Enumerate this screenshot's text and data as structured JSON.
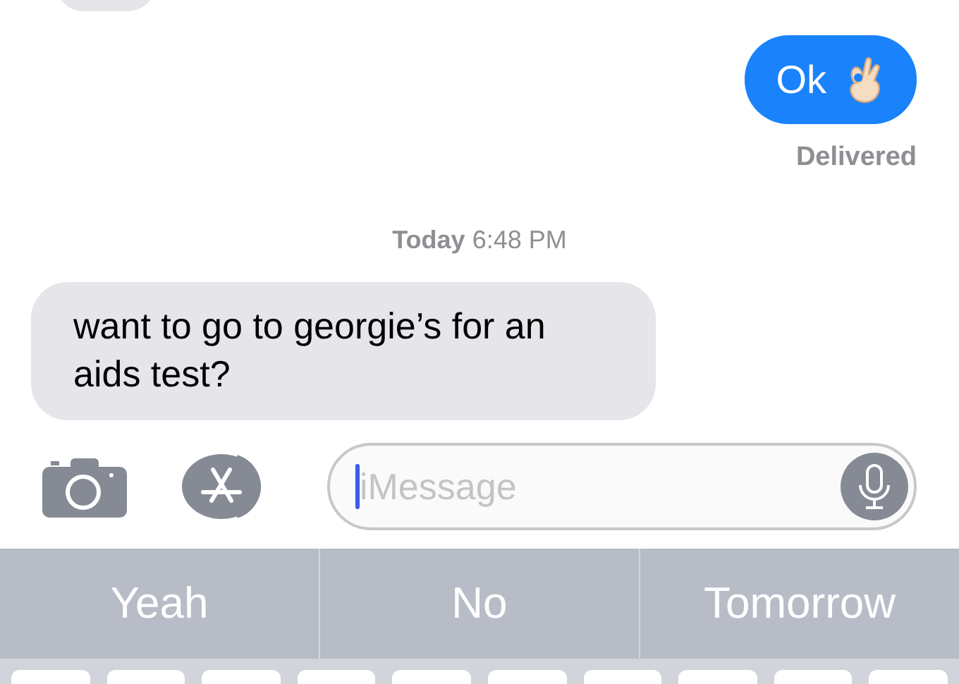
{
  "messages": [
    {
      "kind": "received"
    },
    {
      "kind": "sent",
      "text": "Ok",
      "hand_sign": true
    },
    {
      "kind": "status",
      "text": "Delivered"
    },
    {
      "kind": "timestamp",
      "day": "Today",
      "time": "6:48 PM"
    },
    {
      "kind": "received",
      "text": "want to go to georgie’s for an aids test?"
    }
  ],
  "composer": {
    "placeholder": "iMessage"
  },
  "suggestions": [
    {
      "label": "Yeah"
    },
    {
      "label": "No"
    },
    {
      "label": "Tomorrow"
    }
  ]
}
